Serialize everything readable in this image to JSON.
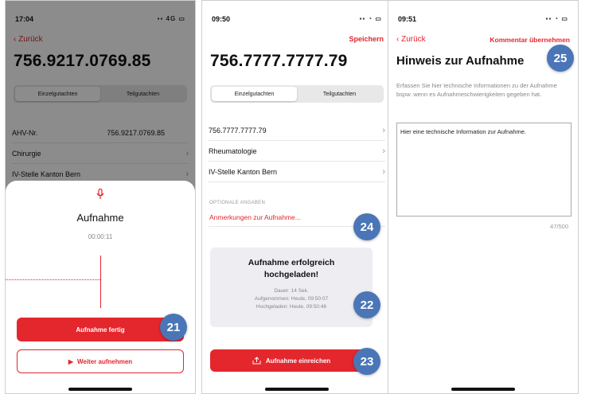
{
  "screen1": {
    "status": {
      "time": "17:04",
      "icons": "▪▪ 4G ▭"
    },
    "back_label": "Zurück",
    "title": "756.9217.0769.85",
    "segments": [
      "Einzelgutachten",
      "Teilgutachten"
    ],
    "rows": [
      {
        "label": "AHV-Nr.",
        "value": "756.9217.0769.85"
      },
      {
        "label": "Chirurgie",
        "value": ""
      },
      {
        "label": "IV-Stelle Kanton Bern",
        "value": ""
      }
    ],
    "sheet": {
      "heading": "Aufnahme",
      "timer": "00:00:11",
      "primary_button": "Aufnahme fertig",
      "secondary_button": "Weiter aufnehmen",
      "secondary_icon": "play-icon"
    },
    "badge": "21"
  },
  "screen2": {
    "status": {
      "time": "09:50",
      "icons": "▪▪ ◔ ▭"
    },
    "save_label": "Speichern",
    "title": "756.7777.7777.79",
    "segments": [
      "Einzelgutachten",
      "Teilgutachten"
    ],
    "rows": [
      "756.7777.7777.79",
      "Rheumatologie",
      "IV-Stelle Kanton Bern"
    ],
    "section_label": "OPTIONALE ANGABEN",
    "remark_link": "Anmerkungen zur Aufnahme...",
    "card": {
      "title_line1": "Aufnahme erfolgreich",
      "title_line2": "hochgeladen!",
      "duration": "Dauer: 14 Sek.",
      "recorded": "Aufgenommen: Heute, 09:50:07",
      "uploaded": "Hochgeladen: Heute, 09:50:46"
    },
    "submit_button": "Aufnahme einreichen",
    "submit_icon": "upload-icon",
    "badges": [
      "24",
      "22",
      "23"
    ]
  },
  "screen3": {
    "status": {
      "time": "09:51",
      "icons": "▪▪ ◔ ▭"
    },
    "back_label": "Zurück",
    "apply_label": "Kommentar übernehmen",
    "title": "Hinweis zur Aufnahme",
    "description": "Erfassen Sie hier technische Informationen zu der Aufnahme bspw. wenn es Aufnahmeschwierigkeiten gegeben hat.",
    "textarea_value": "Hier eine technische Information zur Aufnahme.",
    "char_count": "47/500",
    "badge": "25"
  },
  "colors": {
    "accent": "#e4262d",
    "badge": "#4a76b8"
  }
}
